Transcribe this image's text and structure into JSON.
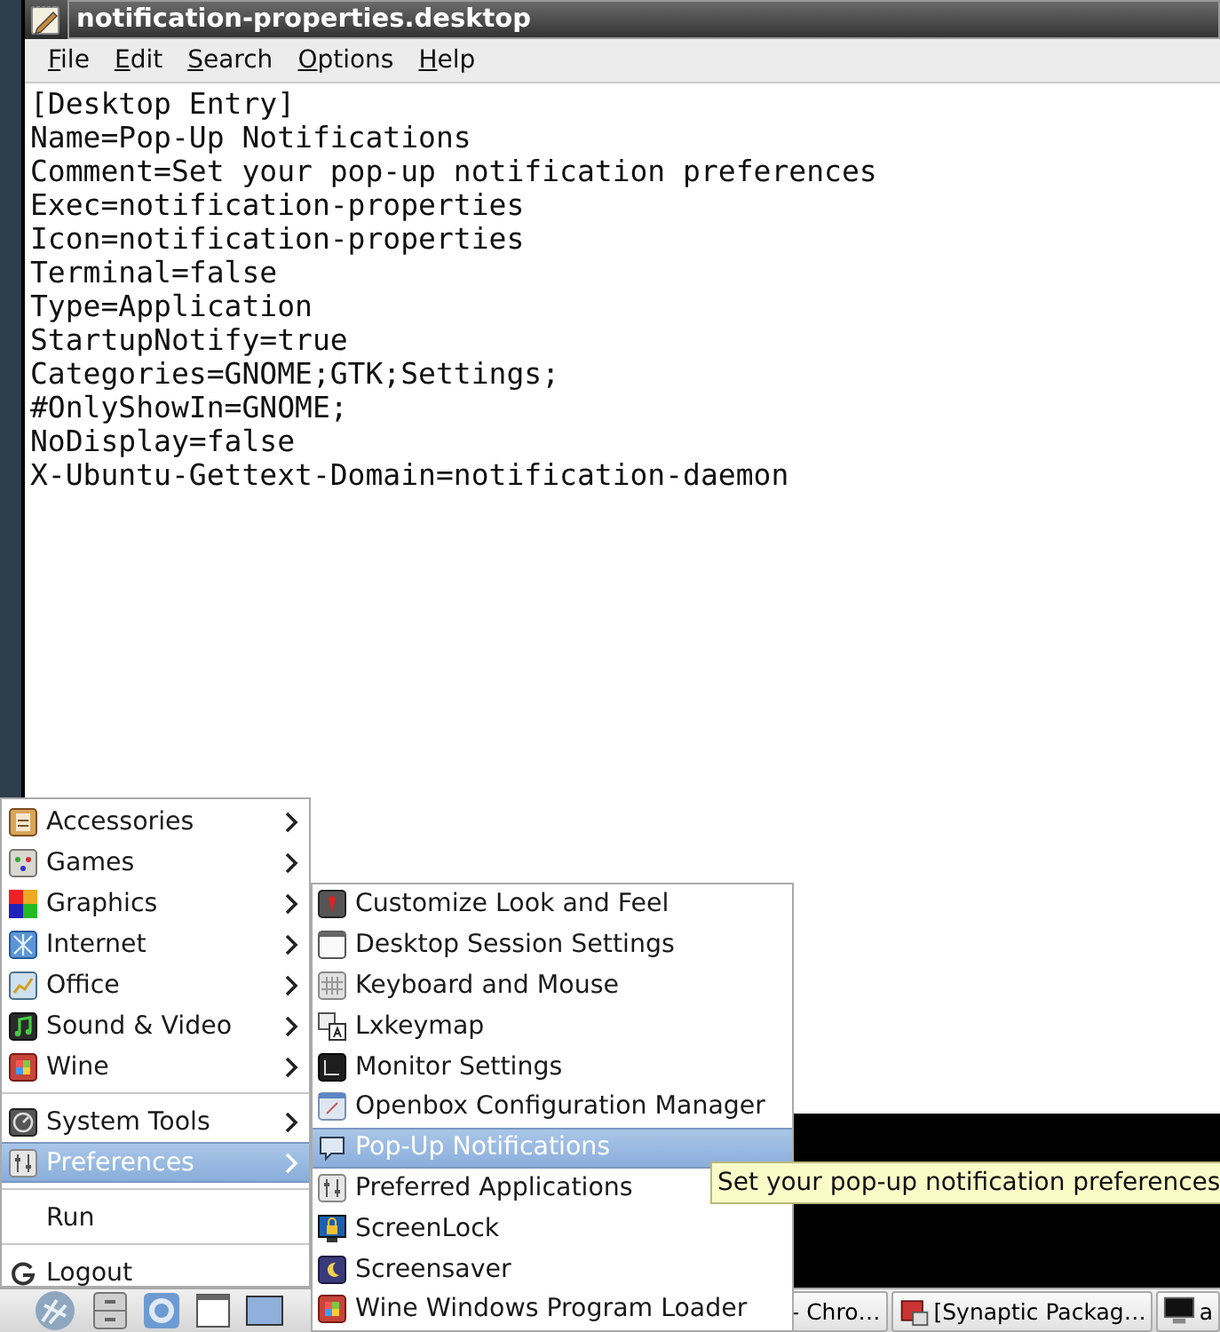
{
  "window": {
    "title": "notification-properties.desktop"
  },
  "menu_bar": [
    {
      "label": "File"
    },
    {
      "label": "Edit"
    },
    {
      "label": "Search"
    },
    {
      "label": "Options"
    },
    {
      "label": "Help"
    }
  ],
  "document": {
    "lines": [
      "[Desktop Entry]",
      "Name=Pop-Up Notifications",
      "Comment=Set your pop-up notification preferences",
      "Exec=notification-properties",
      "Icon=notification-properties",
      "Terminal=false",
      "Type=Application",
      "StartupNotify=true",
      "Categories=GNOME;GTK;Settings;",
      "#OnlyShowIn=GNOME;",
      "NoDisplay=false",
      "X-Ubuntu-Gettext-Domain=notification-daemon"
    ]
  },
  "main_menu": {
    "items": [
      {
        "kind": "submenu",
        "label": "Accessories",
        "selected": false
      },
      {
        "kind": "submenu",
        "label": "Games",
        "selected": false
      },
      {
        "kind": "submenu",
        "label": "Graphics",
        "selected": false
      },
      {
        "kind": "submenu",
        "label": "Internet",
        "selected": false
      },
      {
        "kind": "submenu",
        "label": "Office",
        "selected": false
      },
      {
        "kind": "submenu",
        "label": "Sound & Video",
        "selected": false
      },
      {
        "kind": "submenu",
        "label": "Wine",
        "selected": false
      },
      {
        "kind": "separator"
      },
      {
        "kind": "submenu",
        "label": "System Tools",
        "selected": false
      },
      {
        "kind": "submenu",
        "label": "Preferences",
        "selected": true
      },
      {
        "kind": "separator"
      },
      {
        "kind": "action",
        "label": "Run",
        "selected": false
      },
      {
        "kind": "separator"
      },
      {
        "kind": "action",
        "label": "Logout",
        "selected": false
      }
    ]
  },
  "preferences_menu": {
    "items": [
      {
        "label": "Customize Look and Feel",
        "selected": false
      },
      {
        "label": "Desktop Session Settings",
        "selected": false
      },
      {
        "label": "Keyboard and Mouse",
        "selected": false
      },
      {
        "label": "Lxkeymap",
        "selected": false
      },
      {
        "label": "Monitor Settings",
        "selected": false
      },
      {
        "label": "Openbox Configuration Manager",
        "selected": false
      },
      {
        "label": "Pop-Up Notifications",
        "selected": true
      },
      {
        "label": "Preferred Applications",
        "selected": false
      },
      {
        "label": "ScreenLock",
        "selected": false
      },
      {
        "label": "Screensaver",
        "selected": false
      },
      {
        "label": "Wine Windows Program Loader",
        "selected": false
      }
    ]
  },
  "tooltip": {
    "text": "Set your pop-up notification preferences"
  },
  "taskbar": {
    "tasks": [
      {
        "label": "- Chro…"
      },
      {
        "label": "[Synaptic Packag…"
      },
      {
        "label": "a"
      }
    ]
  }
}
